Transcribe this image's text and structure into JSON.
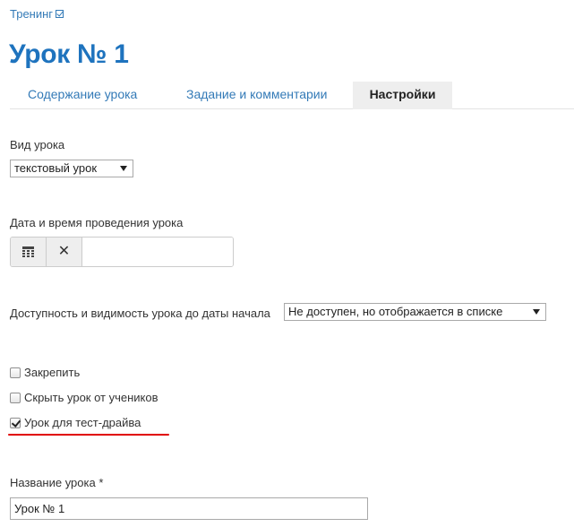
{
  "breadcrumb": {
    "label": "Тренинг"
  },
  "page": {
    "title": "Урок № 1"
  },
  "tabs": [
    {
      "label": "Содержание урока",
      "active": false
    },
    {
      "label": "Задание и комментарии",
      "active": false
    },
    {
      "label": "Настройки",
      "active": true
    }
  ],
  "lesson_type": {
    "label": "Вид урока",
    "value": "текстовый урок"
  },
  "date_time": {
    "label": "Дата и время проведения урока",
    "value": ""
  },
  "availability": {
    "label": "Доступность и видимость урока до даты начала",
    "value": "Не доступен, но отображается в списке"
  },
  "options": [
    {
      "label": "Закрепить",
      "checked": false
    },
    {
      "label": "Скрыть урок от учеников",
      "checked": false
    },
    {
      "label": "Урок для тест-драйва",
      "checked": true
    }
  ],
  "lesson_name": {
    "label": "Название урока *",
    "value": "Урок № 1"
  },
  "colors": {
    "accent": "#1e73be",
    "link": "#337ab7",
    "highlight_underline": "#e00000"
  },
  "icons": {
    "breadcrumb": "external-link-icon",
    "date_pick": "calendar-icon",
    "date_clear": "close-icon"
  }
}
